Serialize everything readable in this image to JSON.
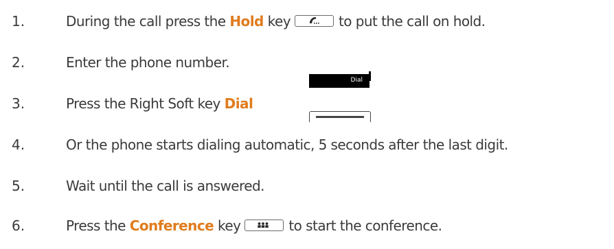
{
  "steps": [
    {
      "number": "1.",
      "before": "During the call press the ",
      "highlight": "Hold",
      "after_highlight": " key",
      "key_icon": "phone-handset-icon",
      "tail": "to put the call on hold."
    },
    {
      "number": "2.",
      "text": "Enter the phone number."
    },
    {
      "number": "3.",
      "before": "Press the Right Soft key ",
      "highlight": "Dial"
    },
    {
      "number": "4.",
      "text": "Or the phone starts dialing automatic, 5 seconds after the last digit."
    },
    {
      "number": "5.",
      "text": "Wait until the call is answered."
    },
    {
      "number": "6.",
      "before": "Press the ",
      "highlight": "Conference",
      "after_highlight": " key",
      "key_icon": "conference-people-icon",
      "tail": "to start the conference."
    }
  ],
  "softkey_screen": {
    "label": "Dial"
  },
  "colors": {
    "text": "#3a3a3a",
    "highlight": "#e07c1d",
    "screen": "#000000"
  }
}
